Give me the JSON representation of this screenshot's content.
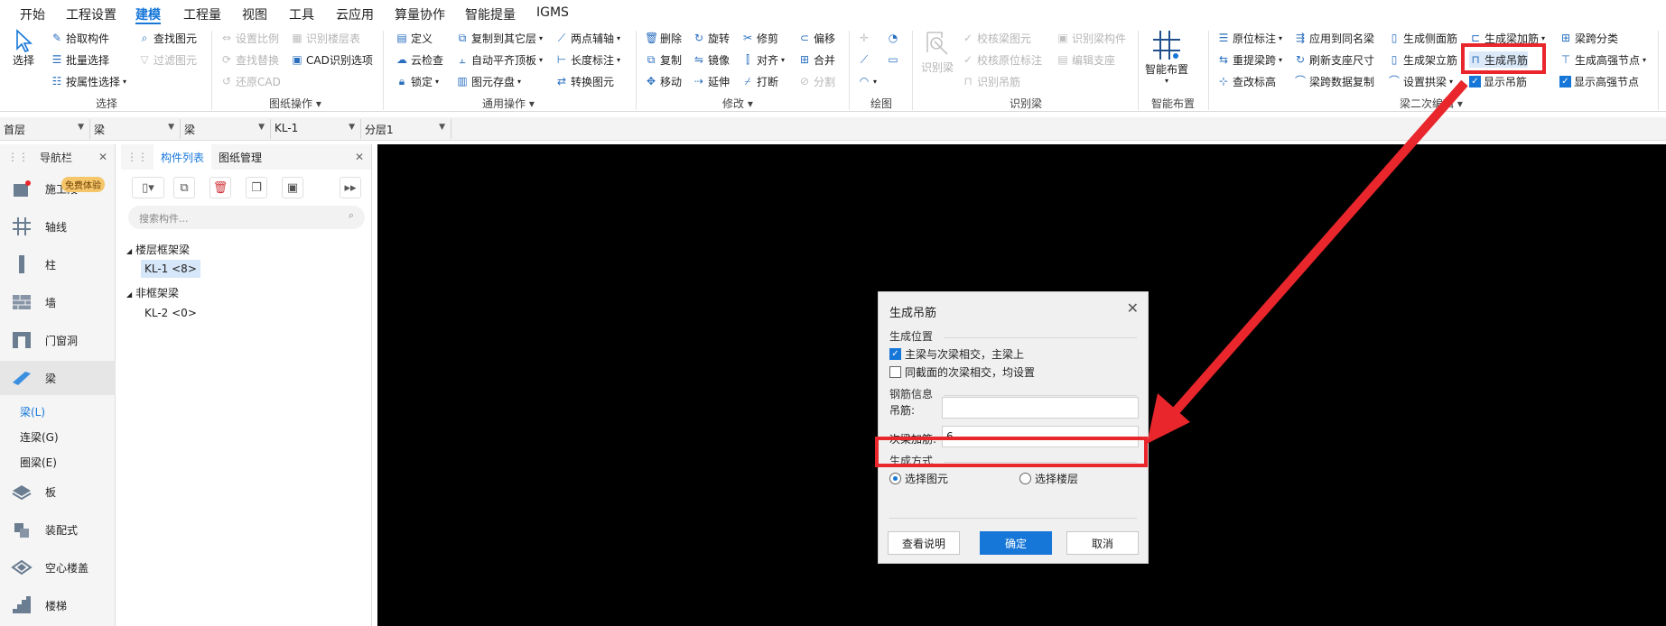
{
  "menu": {
    "items": [
      "开始",
      "工程设置",
      "建模",
      "工程量",
      "视图",
      "工具",
      "云应用",
      "算量协作",
      "智能提量",
      "IGMS"
    ],
    "active": "建模"
  },
  "ribbon": {
    "select_group": {
      "big_select": "选择",
      "pick_component": "拾取构件",
      "batch_select": "批量选择",
      "select_by_attr": "按属性选择",
      "find_element": "查找图元",
      "filter_element": "过滤图元",
      "label": "选择"
    },
    "drawing_group": {
      "set_scale": "设置比例",
      "identify_floor_table": "识别楼层表",
      "find_replace": "查找替换",
      "cad_options": "CAD识别选项",
      "restore_cad": "还原CAD",
      "label": "图纸操作"
    },
    "general_group": {
      "define": "定义",
      "copy_to_other_floor": "复制到其它层",
      "two_point_axis": "两点辅轴",
      "cloud_check": "云检查",
      "auto_flush_slab": "自动平齐顶板",
      "length_mark": "长度标注",
      "lock": "锁定",
      "element_save": "图元存盘",
      "convert_element": "转换图元",
      "label": "通用操作"
    },
    "modify_group": {
      "delete": "删除",
      "rotate": "旋转",
      "trim": "修剪",
      "offset": "偏移",
      "copy": "复制",
      "mirror": "镜像",
      "align": "对齐",
      "merge": "合并",
      "move": "移动",
      "extend": "延伸",
      "break": "打断",
      "split": "分割",
      "label": "修改"
    },
    "draw_group": {
      "label": "绘图"
    },
    "identify_beam_group": {
      "identify_beam": "识别梁",
      "check_beam_element": "校核梁图元",
      "identify_beam_component": "识别梁构件",
      "check_original_mark": "校核原位标注",
      "edit_support": "编辑支座",
      "identify_hanger": "识别吊筋",
      "label": "识别梁"
    },
    "smart_group": {
      "smart_layout": "智能布置",
      "label": "智能布置"
    },
    "beam_edit_group": {
      "original_mark": "原位标注",
      "apply_same_name": "应用到同名梁",
      "gen_side_rebar": "生成侧面筋",
      "gen_beam_stirrup": "生成梁加筋",
      "beam_span_classify": "梁跨分类",
      "re_extract_span": "重提梁跨",
      "refresh_support_size": "刷新支座尺寸",
      "gen_frame_column": "生成架立筋",
      "gen_hanger": "生成吊筋",
      "gen_haunch_node": "生成高强节点",
      "check_elevation": "查改标高",
      "span_data_copy": "梁跨数据复制",
      "set_arch_beam": "设置拱梁",
      "show_hanger": "显示吊筋",
      "show_haunch_node": "显示高强节点",
      "label": "梁二次编辑"
    }
  },
  "toolbar2": {
    "floor": "首层",
    "type1": "梁",
    "type2": "梁",
    "component": "KL-1",
    "layer": "分层1"
  },
  "nav": {
    "title": "导航栏",
    "badge": "免费体验",
    "items": [
      "施工段",
      "轴线",
      "柱",
      "墙",
      "门窗洞",
      "梁",
      "板",
      "装配式",
      "空心楼盖",
      "楼梯"
    ],
    "sub_items": [
      "梁(L)",
      "连梁(G)",
      "圈梁(E)"
    ]
  },
  "components": {
    "tabs": [
      "构件列表",
      "图纸管理"
    ],
    "search_placeholder": "搜索构件...",
    "tree": [
      {
        "group": "楼层框架梁",
        "children": [
          "KL-1 <8>"
        ]
      },
      {
        "group": "非框架梁",
        "children": [
          "KL-2 <0>"
        ]
      }
    ]
  },
  "dialog": {
    "title": "生成吊筋",
    "section_position": "生成位置",
    "opt_main_secondary": "主梁与次梁相交，主梁上",
    "opt_same_section": "同截面的次梁相交，均设置",
    "section_rebar": "钢筋信息",
    "hanger_label": "吊筋:",
    "hanger_value": "",
    "secondary_label": "次梁加筋:",
    "secondary_value": "6",
    "section_method": "生成方式",
    "method_select_element": "选择图元",
    "method_select_floor": "选择楼层",
    "btn_help": "查看说明",
    "btn_ok": "确定",
    "btn_cancel": "取消"
  },
  "colors": {
    "accent": "#1677d9",
    "highlight": "#e8262c",
    "canvas": "#000000"
  }
}
